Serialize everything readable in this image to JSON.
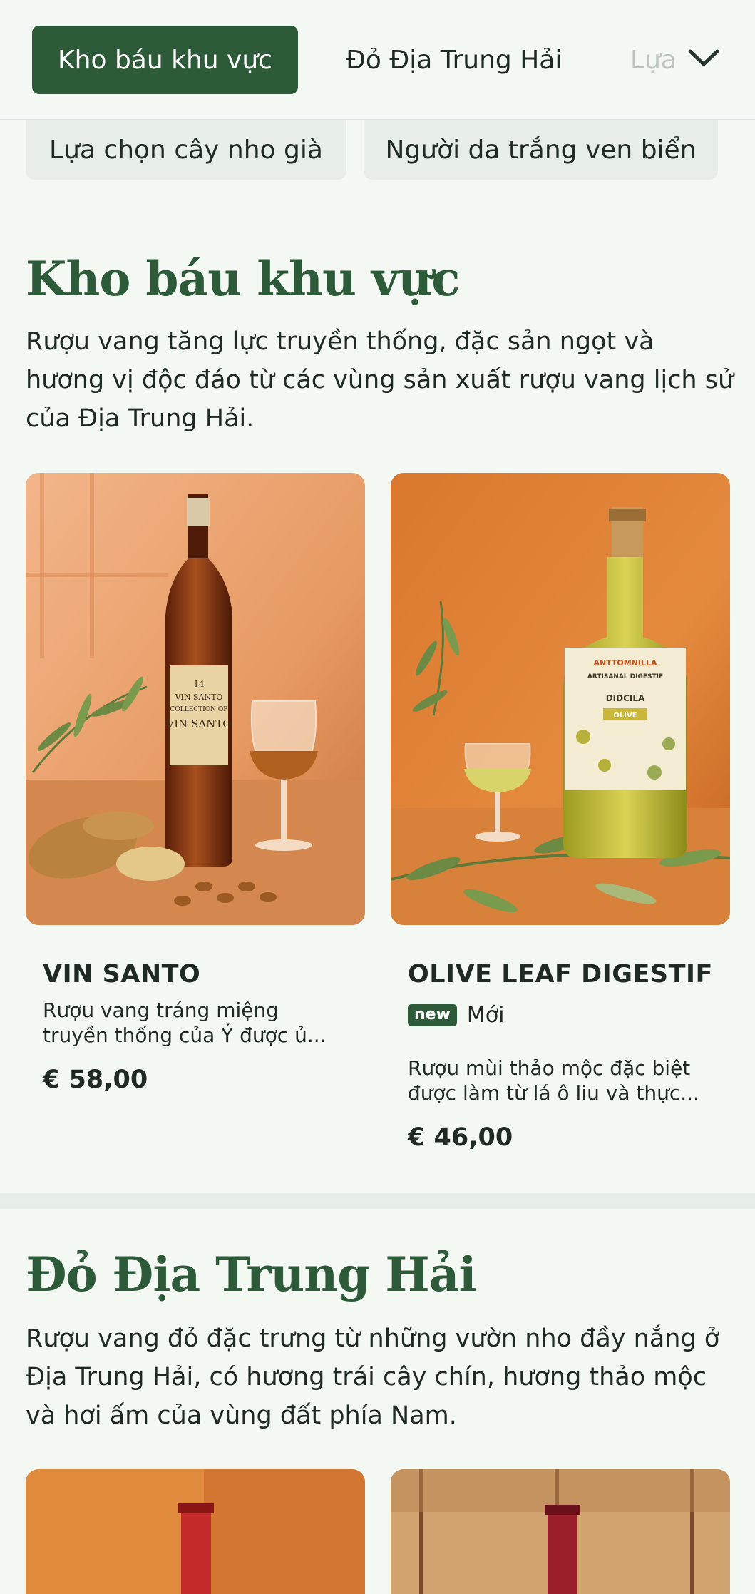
{
  "tabs": {
    "active": "Kho báu khu vực",
    "second": "Đỏ Địa Trung Hải",
    "third": "Lựa chọn cây nho già"
  },
  "chips": [
    {
      "label": "Lựa chọn cây nho già"
    },
    {
      "label": "Người da trắng ven biển"
    }
  ],
  "sections": [
    {
      "title": "Kho báu khu vực",
      "description": "Rượu vang tăng lực truyền thống, đặc sản ngọt và hương vị độc đáo từ các vùng sản xuất rượu vang lịch sử của Địa Trung Hải.",
      "products": [
        {
          "name": "VIN SANTO",
          "description": "Rượu vang tráng miệng truyền thống của Ý được ủ...",
          "price": "€ 58,00",
          "image_label": [
            "14",
            "VIN SANTO",
            "COLLECTION OF",
            "VIN SANTO"
          ]
        },
        {
          "name": "OLIVE LEAF DIGESTIF",
          "badge": "new",
          "badge_text": "Mới",
          "description": "Rượu mùi thảo mộc đặc biệt được làm từ lá ô liu và thực...",
          "price": "€ 46,00",
          "image_label": [
            "ANTTOMNILLA",
            "ARTISANAL DIGESTIF",
            "DIDCILA",
            "OLIVE"
          ]
        }
      ]
    },
    {
      "title": "Đỏ Địa Trung Hải",
      "description": "Rượu vang đỏ đặc trưng từ những vườn nho đầy nắng ở Địa Trung Hải, có hương trái cây chín, hương thảo mộc và hơi ấm của vùng đất phía Nam."
    }
  ],
  "colors": {
    "brand_green": "#2d5a38",
    "background": "#f3f8f3",
    "chip_bg": "#e7eee8"
  },
  "icons": {
    "tab_overflow": "chevron-down-icon"
  }
}
